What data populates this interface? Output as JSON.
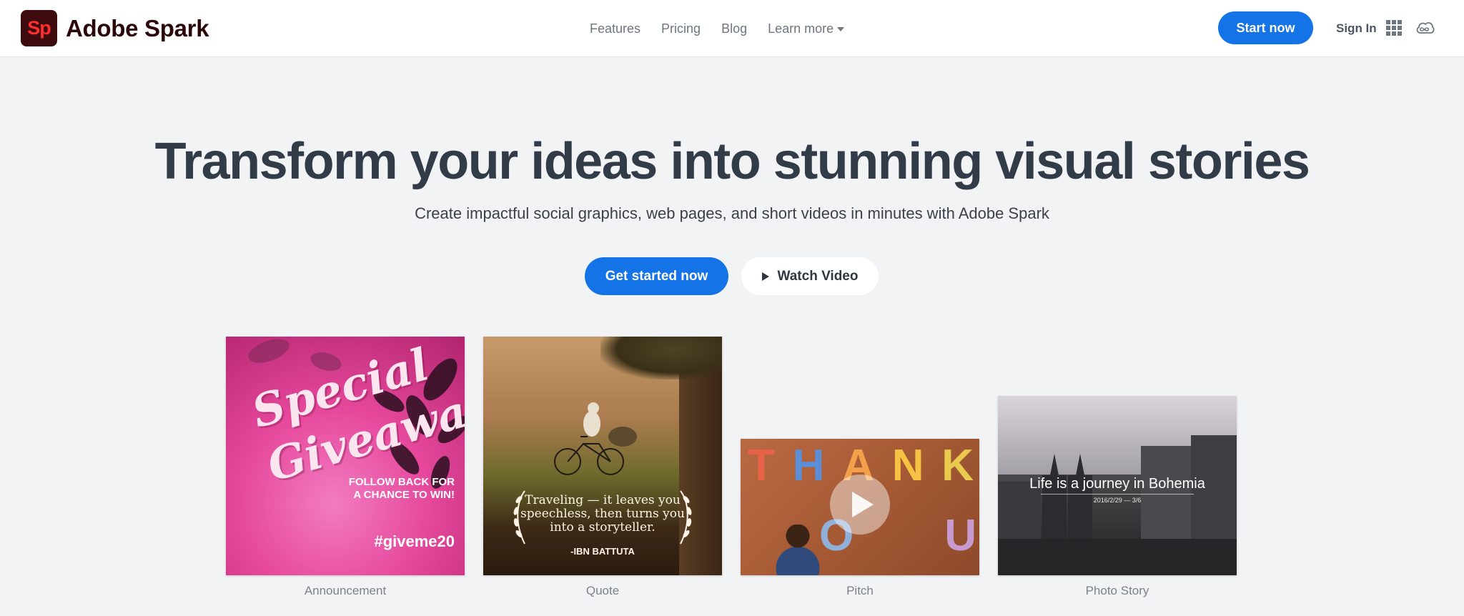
{
  "header": {
    "logo_mark": "Sp",
    "brand": "Adobe Spark",
    "nav": [
      "Features",
      "Pricing",
      "Blog",
      "Learn more"
    ],
    "cta": "Start now",
    "sign_in": "Sign In",
    "icons": [
      "apps-grid-icon",
      "creative-cloud-icon"
    ]
  },
  "hero": {
    "title": "Transform your ideas into stunning visual stories",
    "subtitle": "Create impactful social graphics, web pages, and short videos in minutes with Adobe Spark",
    "primary_button": "Get started now",
    "secondary_button": "Watch Video"
  },
  "cards": [
    {
      "label": "Announcement",
      "art": {
        "headline_1": "Special",
        "headline_2": "Giveaway",
        "follow_1": "FOLLOW BACK FOR",
        "follow_2": "A CHANCE TO WIN!",
        "hashtag": "#giveme20"
      }
    },
    {
      "label": "Quote",
      "art": {
        "quote": "Traveling — it leaves you speechless, then turns you into a storyteller.",
        "author": "-IBN BATTUTA"
      }
    },
    {
      "label": "Pitch",
      "art": {
        "word_1": [
          "T",
          "H",
          "A",
          "N",
          "K"
        ],
        "word_2": [
          "O",
          "U"
        ]
      }
    },
    {
      "label": "Photo Story",
      "art": {
        "title": "Life is a journey in Bohemia",
        "date": "2016/2/29 — 3/6"
      }
    }
  ],
  "colors": {
    "accent": "#1473e6",
    "background": "#f2f3f5",
    "logo_bg": "#3d0b0e",
    "logo_fg": "#ff2f2f"
  }
}
